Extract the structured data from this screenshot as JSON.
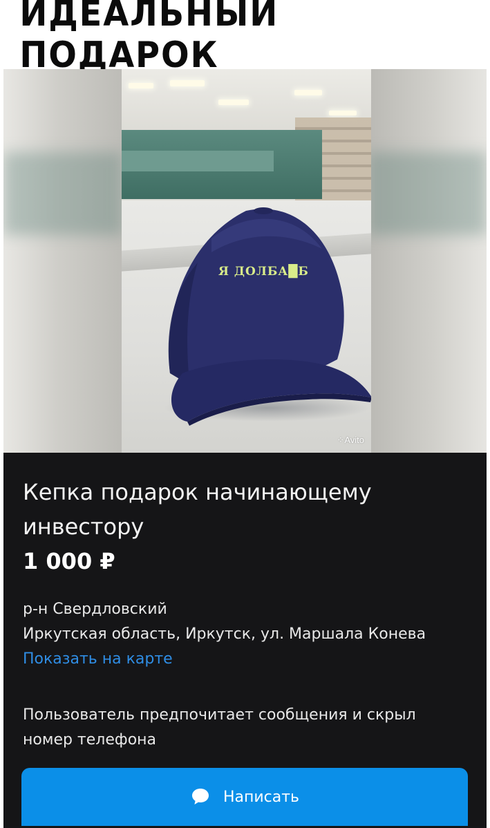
{
  "meme": {
    "caption": "ИДЕАЛЬНЫЙ ПОДАРОК"
  },
  "photo": {
    "cap_text": "Я ДОЛБА█Б",
    "watermark": "Avito",
    "colors": {
      "cap": "#2b2f6b",
      "cap_text": "#d9ec8a"
    }
  },
  "listing": {
    "title": "Кепка подарок начинающему инвестору",
    "price": "1 000 ₽",
    "district": "р-н Свердловский",
    "address": "Иркутская область, Иркутск, ул. Маршала Конева",
    "map_link": "Показать на карте",
    "contact_note": "Пользователь предпочитает сообщения и скрыл номер телефона",
    "write_button": {
      "label": "Написать",
      "icon": "chat-bubble-icon"
    },
    "colors": {
      "background": "#151517",
      "link": "#2f8de4",
      "button": "#0b8fe8"
    }
  }
}
